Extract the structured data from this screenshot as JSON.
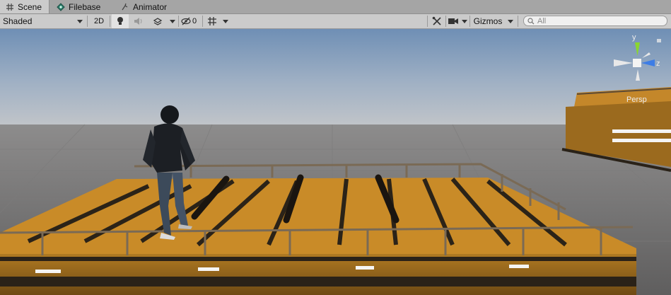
{
  "tabs": [
    {
      "label": "Scene",
      "icon": "grid-icon",
      "active": true
    },
    {
      "label": "Filebase",
      "icon": "filebase-icon",
      "active": false
    },
    {
      "label": "Animator",
      "icon": "animator-icon",
      "active": false
    }
  ],
  "toolbar": {
    "draw_mode": "Shaded",
    "mode_2d_label": "2D",
    "hidden_count": "0",
    "gizmos_label": "Gizmos",
    "search_placeholder": "All"
  },
  "gizmo": {
    "y_label": "y",
    "z_label": "z",
    "projection_label": "Persp",
    "colors": {
      "y": "#8ad62f",
      "z": "#3d7de6",
      "x": "#e8e8e8"
    }
  },
  "scene": {
    "sky_top": "#6f8fb5",
    "horizon": "#b8bfc8",
    "ground": "#6c6b6b",
    "deck_color": "#c98b28",
    "rail_color": "#7a6a55"
  }
}
